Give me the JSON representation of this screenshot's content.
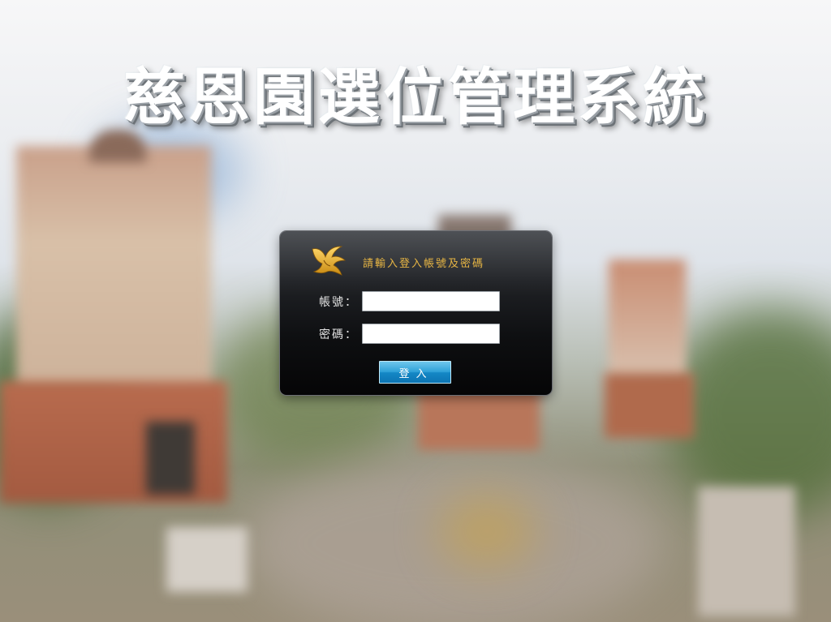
{
  "page": {
    "title": "慈恩園選位管理系統"
  },
  "login": {
    "prompt": "請輸入登入帳號及密碼",
    "account_label": "帳號：",
    "password_label": "密碼：",
    "account_value": "",
    "password_value": "",
    "submit_label": "登入"
  },
  "colors": {
    "prompt_gold": "#e6b544",
    "button_blue": "#1f93d0",
    "panel_dark": "#101113"
  },
  "icons": {
    "logo": "phoenix-logo-icon"
  }
}
